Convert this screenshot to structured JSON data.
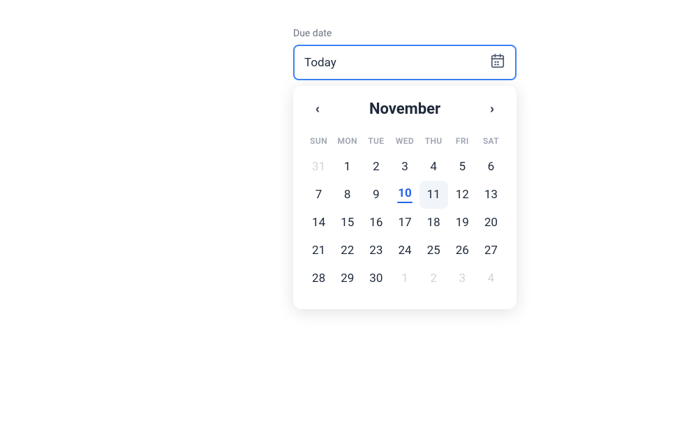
{
  "label": {
    "due_date": "Due date"
  },
  "input": {
    "value": "Today",
    "placeholder": "Today"
  },
  "calendar": {
    "month": "November",
    "prev_label": "‹",
    "next_label": "›",
    "weekdays": [
      "SUN",
      "MON",
      "TUE",
      "WED",
      "THU",
      "FRI",
      "SAT"
    ],
    "weeks": [
      [
        {
          "day": "31",
          "other": true
        },
        {
          "day": "1",
          "other": false
        },
        {
          "day": "2",
          "other": false
        },
        {
          "day": "3",
          "other": false
        },
        {
          "day": "4",
          "other": false
        },
        {
          "day": "5",
          "other": false
        },
        {
          "day": "6",
          "other": false
        }
      ],
      [
        {
          "day": "7",
          "other": false
        },
        {
          "day": "8",
          "other": false
        },
        {
          "day": "9",
          "other": false
        },
        {
          "day": "10",
          "other": false,
          "today": true
        },
        {
          "day": "11",
          "other": false,
          "hovered": true
        },
        {
          "day": "12",
          "other": false
        },
        {
          "day": "13",
          "other": false
        }
      ],
      [
        {
          "day": "14",
          "other": false
        },
        {
          "day": "15",
          "other": false
        },
        {
          "day": "16",
          "other": false
        },
        {
          "day": "17",
          "other": false
        },
        {
          "day": "18",
          "other": false
        },
        {
          "day": "19",
          "other": false
        },
        {
          "day": "20",
          "other": false
        }
      ],
      [
        {
          "day": "21",
          "other": false
        },
        {
          "day": "22",
          "other": false
        },
        {
          "day": "23",
          "other": false
        },
        {
          "day": "24",
          "other": false
        },
        {
          "day": "25",
          "other": false
        },
        {
          "day": "26",
          "other": false
        },
        {
          "day": "27",
          "other": false
        }
      ],
      [
        {
          "day": "28",
          "other": false
        },
        {
          "day": "29",
          "other": false
        },
        {
          "day": "30",
          "other": false
        },
        {
          "day": "1",
          "other": true
        },
        {
          "day": "2",
          "other": true
        },
        {
          "day": "3",
          "other": true
        },
        {
          "day": "4",
          "other": true
        }
      ]
    ]
  }
}
